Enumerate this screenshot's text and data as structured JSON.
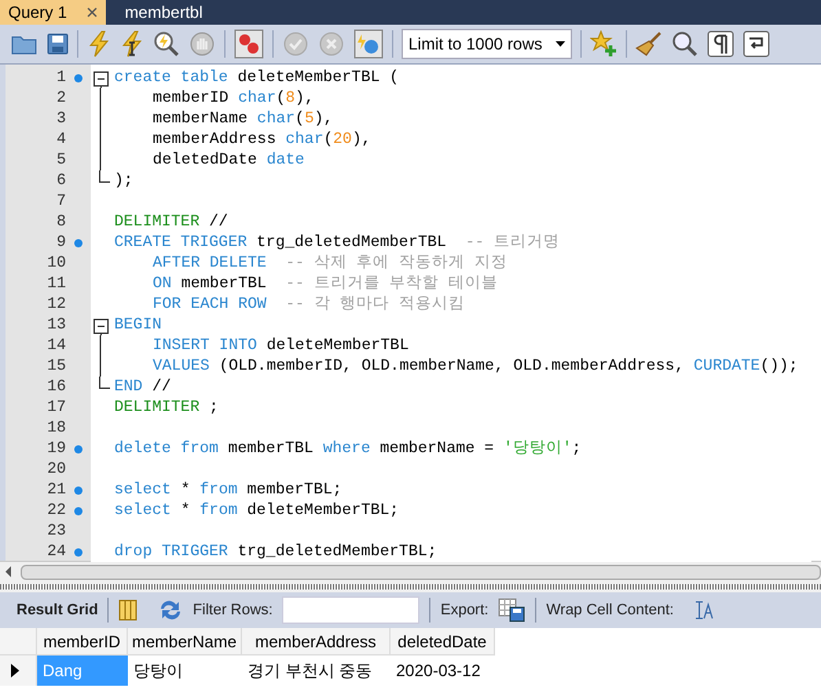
{
  "tabs": [
    {
      "label": "Query 1",
      "selected": true,
      "closable": true
    },
    {
      "label": "membertbl",
      "selected": false,
      "closable": false
    }
  ],
  "toolbar": {
    "limit_select": "Limit to 1000 rows"
  },
  "editor": {
    "lines": [
      {
        "number": "1",
        "statement": true,
        "kind": "start",
        "indent": false,
        "tokens": [
          {
            "kind": "kw",
            "text": "create table"
          },
          {
            "kind": "plain",
            "text": " deleteMemberTBL ("
          }
        ]
      },
      {
        "number": "2",
        "statement": false,
        "kind": "inside",
        "indent": true,
        "tokens": [
          {
            "kind": "plain",
            "text": "memberID "
          },
          {
            "kind": "kw",
            "text": "char"
          },
          {
            "kind": "plain",
            "text": "("
          },
          {
            "kind": "num",
            "text": "8"
          },
          {
            "kind": "plain",
            "text": "),"
          }
        ]
      },
      {
        "number": "3",
        "statement": false,
        "kind": "inside",
        "indent": true,
        "tokens": [
          {
            "kind": "plain",
            "text": "memberName "
          },
          {
            "kind": "kw",
            "text": "char"
          },
          {
            "kind": "plain",
            "text": "("
          },
          {
            "kind": "num",
            "text": "5"
          },
          {
            "kind": "plain",
            "text": "),"
          }
        ]
      },
      {
        "number": "4",
        "statement": false,
        "kind": "inside",
        "indent": true,
        "tokens": [
          {
            "kind": "plain",
            "text": "memberAddress "
          },
          {
            "kind": "kw",
            "text": "char"
          },
          {
            "kind": "plain",
            "text": "("
          },
          {
            "kind": "num",
            "text": "20"
          },
          {
            "kind": "plain",
            "text": "),"
          }
        ]
      },
      {
        "number": "5",
        "statement": false,
        "kind": "inside",
        "indent": true,
        "tokens": [
          {
            "kind": "plain",
            "text": "deletedDate "
          },
          {
            "kind": "kw",
            "text": "date"
          }
        ]
      },
      {
        "number": "6",
        "statement": false,
        "kind": "end",
        "indent": false,
        "tokens": [
          {
            "kind": "plain",
            "text": ");"
          }
        ]
      },
      {
        "number": "7",
        "statement": false,
        "kind": "plain"
      },
      {
        "number": "8",
        "statement": false,
        "kind": "plain",
        "indent": false,
        "tokens": [
          {
            "kind": "delim",
            "text": "DELIMITER"
          },
          {
            "kind": "plain",
            "text": " //"
          }
        ]
      },
      {
        "number": "9",
        "statement": true,
        "kind": "plain",
        "indent": false,
        "tokens": [
          {
            "kind": "kw",
            "text": "CREATE TRIGGER"
          },
          {
            "kind": "plain",
            "text": " trg_deletedMemberTBL"
          },
          {
            "kind": "comment",
            "text": "-- 트리거명"
          }
        ]
      },
      {
        "number": "10",
        "statement": false,
        "kind": "plain",
        "indent": true,
        "tokens": [
          {
            "kind": "kw",
            "text": "AFTER DELETE"
          },
          {
            "kind": "comment",
            "text": "-- 삭제 후에 작동하게 지정"
          }
        ]
      },
      {
        "number": "11",
        "statement": false,
        "kind": "plain",
        "indent": true,
        "tokens": [
          {
            "kind": "kw",
            "text": "ON"
          },
          {
            "kind": "plain",
            "text": " memberTBL"
          },
          {
            "kind": "comment",
            "text": "-- 트리거를 부착할 테이블"
          }
        ]
      },
      {
        "number": "12",
        "statement": false,
        "kind": "plain",
        "indent": true,
        "tokens": [
          {
            "kind": "kw",
            "text": "FOR EACH ROW"
          },
          {
            "kind": "comment",
            "text": "-- 각 행마다 적용시킴"
          }
        ]
      },
      {
        "number": "13",
        "statement": false,
        "kind": "start",
        "indent": false,
        "tokens": [
          {
            "kind": "kw",
            "text": "BEGIN"
          }
        ]
      },
      {
        "number": "14",
        "statement": false,
        "kind": "inside",
        "indent": true,
        "tokens": [
          {
            "kind": "kw",
            "text": "INSERT INTO"
          },
          {
            "kind": "plain",
            "text": " deleteMemberTBL"
          }
        ]
      },
      {
        "number": "15",
        "statement": false,
        "kind": "inside",
        "indent": true,
        "tokens": [
          {
            "kind": "kw",
            "text": "VALUES"
          },
          {
            "kind": "plain",
            "text": " (OLD.memberID, OLD.memberName, OLD.memberAddress, "
          },
          {
            "kind": "kw",
            "text": "CURDATE"
          },
          {
            "kind": "plain",
            "text": "());"
          }
        ]
      },
      {
        "number": "16",
        "statement": false,
        "kind": "end",
        "indent": false,
        "tokens": [
          {
            "kind": "kw",
            "text": "END"
          },
          {
            "kind": "plain",
            "text": " //"
          }
        ]
      },
      {
        "number": "17",
        "statement": false,
        "kind": "plain",
        "indent": false,
        "tokens": [
          {
            "kind": "delim",
            "text": "DELIMITER"
          },
          {
            "kind": "plain",
            "text": " ;"
          }
        ]
      },
      {
        "number": "18",
        "statement": false,
        "kind": "plain"
      },
      {
        "number": "19",
        "statement": true,
        "kind": "plain",
        "indent": false,
        "tokens": [
          {
            "kind": "kw",
            "text": "delete from"
          },
          {
            "kind": "plain",
            "text": " memberTBL "
          },
          {
            "kind": "kw",
            "text": "where"
          },
          {
            "kind": "plain",
            "text": " memberName = "
          },
          {
            "kind": "str",
            "text": "'당탕이'"
          },
          {
            "kind": "plain",
            "text": ";"
          }
        ]
      },
      {
        "number": "20",
        "statement": false,
        "kind": "plain"
      },
      {
        "number": "21",
        "statement": true,
        "kind": "plain",
        "indent": false,
        "tokens": [
          {
            "kind": "kw",
            "text": "select"
          },
          {
            "kind": "plain",
            "text": " * "
          },
          {
            "kind": "kw",
            "text": "from"
          },
          {
            "kind": "plain",
            "text": " memberTBL;"
          }
        ]
      },
      {
        "number": "22",
        "statement": true,
        "kind": "plain",
        "indent": false,
        "tokens": [
          {
            "kind": "kw",
            "text": "select"
          },
          {
            "kind": "plain",
            "text": " * "
          },
          {
            "kind": "kw",
            "text": "from"
          },
          {
            "kind": "plain",
            "text": " deleteMemberTBL;"
          }
        ]
      },
      {
        "number": "23",
        "statement": false,
        "kind": "plain"
      },
      {
        "number": "24",
        "statement": true,
        "kind": "plain",
        "indent": false,
        "tokens": [
          {
            "kind": "kw",
            "text": "drop TRIGGER"
          },
          {
            "kind": "plain",
            "text": " trg_deletedMemberTBL;"
          }
        ]
      }
    ]
  },
  "result_toolbar": {
    "result_grid": "Result Grid",
    "filter_label": "Filter Rows:",
    "export_label": "Export:",
    "wrap_label": "Wrap Cell Content:"
  },
  "result": {
    "columns": [
      "memberID",
      "memberName",
      "memberAddress",
      "deletedDate"
    ],
    "rows": [
      {
        "current": true,
        "cells": [
          {
            "text": "Dang",
            "selected": true
          },
          {
            "text": "당탕이",
            "selected": false
          },
          {
            "text": "경기 부천시 중동",
            "selected": false
          },
          {
            "text": "2020-03-12",
            "selected": false
          }
        ]
      }
    ]
  }
}
